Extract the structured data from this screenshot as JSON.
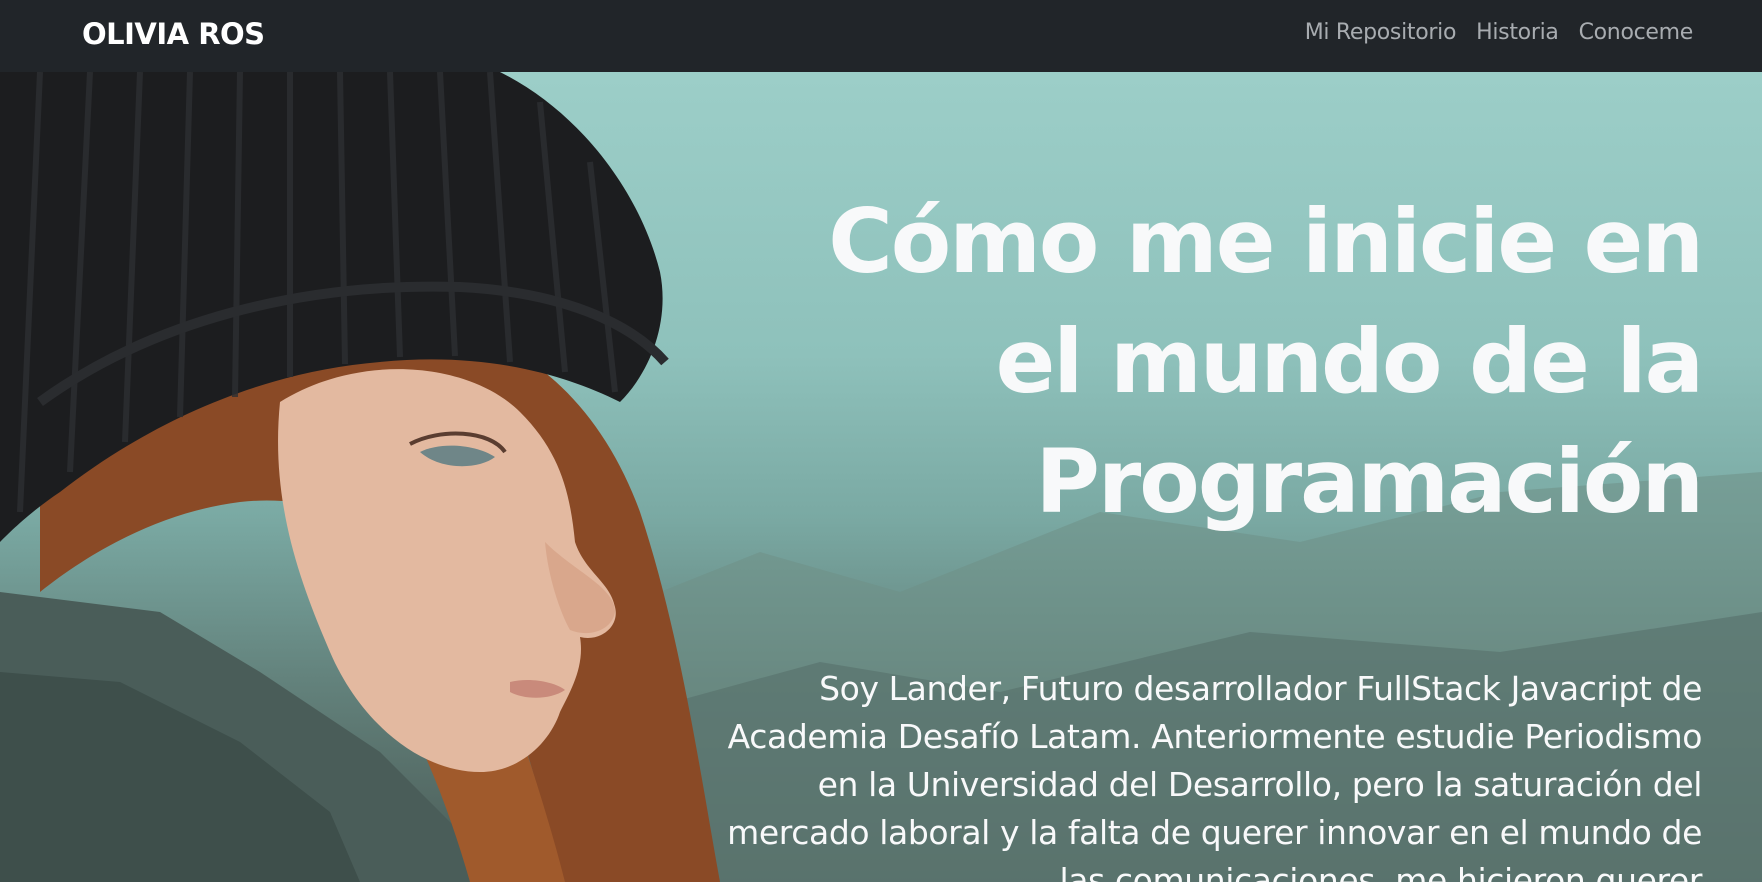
{
  "navbar": {
    "brand": "OLIVIA ROS",
    "links": [
      "Mi Repositorio",
      "Historia",
      "Conoceme"
    ]
  },
  "hero": {
    "title": "Cómo me inicie en el mundo de la Programación",
    "text": "Soy Lander, Futuro desarrollador FullStack Javacript de Academia Desafío Latam. Anteriormente estudie Periodismo en la Universidad del Desarrollo, pero la saturación del mercado laboral y la falta de querer innovar en el mundo de las comunicaciones, me hicieron querer"
  },
  "colors": {
    "navbar_bg": "#212529",
    "brand": "#ffffff",
    "nav_link": "#a8acb0",
    "hero_text": "#f8f9fa"
  }
}
